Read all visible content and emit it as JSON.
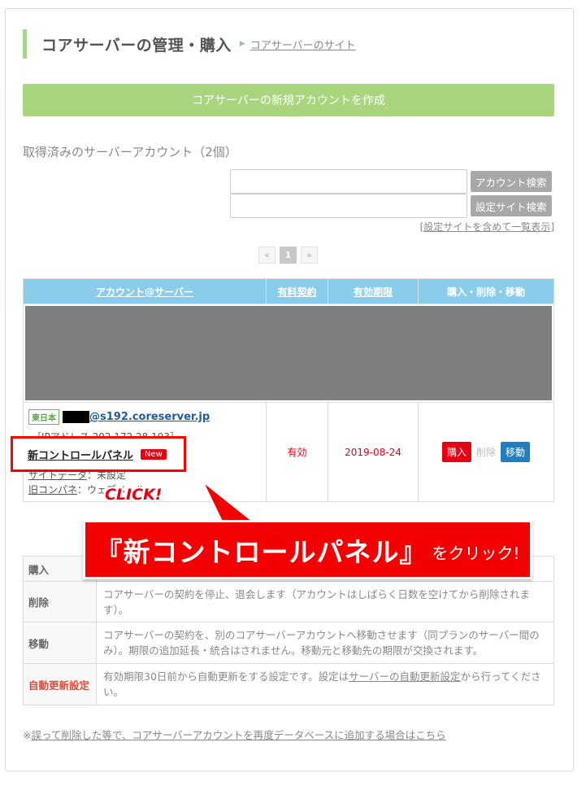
{
  "header": {
    "title": "コアサーバーの管理・購入",
    "site_link": "コアサーバーのサイト"
  },
  "new_account_button": "コアサーバーの新規アカウントを作成",
  "accounts_heading": "取得済みのサーバーアカウント（2個）",
  "search": {
    "account_value": "",
    "account_button": "アカウント検索",
    "site_value": "",
    "site_button": "設定サイト検索",
    "list_all": "設定サイトを含めて一覧表示",
    "list_all_open": "[",
    "list_all_close": "]"
  },
  "pagination": {
    "prev": "«",
    "current": "1",
    "next": "»"
  },
  "table": {
    "headers": [
      "アカウント@サーバー",
      "有料契約",
      "有効期限",
      "購入・削除・移動"
    ],
    "row": {
      "region": "東日本",
      "domain": "@s192.coreserver.jp",
      "ip": "［IPアドレス 202.172.28.193］",
      "site_label": "サイトデータ",
      "site_value": "：未設定",
      "old_label": "旧コンパネ",
      "old_value": "：ウェブメール",
      "status": "有効",
      "expiry": "2019-08-24",
      "actions": {
        "buy": "購入",
        "delete": "削除",
        "move": "移動"
      }
    }
  },
  "highlight": {
    "label": "新コントロールパネル",
    "badge": "New"
  },
  "annotation": {
    "click": "CLICK!",
    "callout_main": "『新コントロールパネル』",
    "callout_sub": "をクリック!"
  },
  "legend": [
    {
      "key": "購入",
      "desc": ""
    },
    {
      "key": "削除",
      "desc": "コアサーバーの契約を停止、退会します（アカウントはしばらく日数を空けてから削除されます）。"
    },
    {
      "key": "移動",
      "desc": "コアサーバーの契約を、別のコアサーバーアカウントへ移動させます（同プランのサーバー間のみ）。期限の追加延長・統合はされません。移動元と移動先の期限が交換されます。"
    },
    {
      "key": "自動更新設定",
      "desc_before": "有効期限30日前から自動更新をする設定です。設定は",
      "desc_link": "サーバーの自動更新設定",
      "desc_after": "から行ってください。"
    }
  ],
  "footnote": {
    "prefix": "※",
    "link": "誤って削除した等で、コアサーバーアカウントを再度データベースに追加する場合はこちら"
  },
  "colors": {
    "accent_green": "#a9d57f",
    "table_header": "#8acdea",
    "red": "#e60012",
    "move_blue": "#1d7fc0"
  }
}
